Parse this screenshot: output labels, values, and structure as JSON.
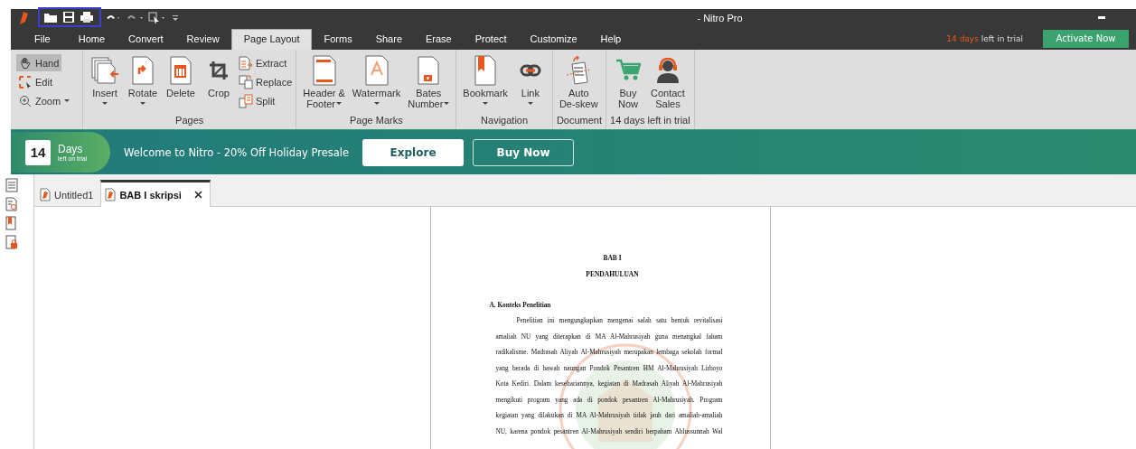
{
  "window": {
    "title": "- Nitro Pro"
  },
  "menu_tabs": [
    {
      "label": "File",
      "selected": false
    },
    {
      "label": "Home",
      "selected": false
    },
    {
      "label": "Convert",
      "selected": false
    },
    {
      "label": "Review",
      "selected": false
    },
    {
      "label": "Page Layout",
      "selected": true
    },
    {
      "label": "Forms",
      "selected": false
    },
    {
      "label": "Share",
      "selected": false
    },
    {
      "label": "Erase",
      "selected": false
    },
    {
      "label": "Protect",
      "selected": false
    },
    {
      "label": "Customize",
      "selected": false
    },
    {
      "label": "Help",
      "selected": false
    }
  ],
  "trial_notice": {
    "days": "14 days",
    "text": "left in trial"
  },
  "activate_button": "Activate Now",
  "tools": [
    {
      "label": "Hand",
      "selected": true,
      "dropdown": false
    },
    {
      "label": "Edit",
      "selected": false,
      "dropdown": false
    },
    {
      "label": "Zoom",
      "selected": false,
      "dropdown": true
    }
  ],
  "ribbon_groups": [
    {
      "label": "Pages",
      "buttons": [
        {
          "kind": "large",
          "lines": [
            "Insert"
          ],
          "dropdown": true
        },
        {
          "kind": "large",
          "lines": [
            "Rotate"
          ],
          "dropdown": true
        },
        {
          "kind": "large",
          "lines": [
            "Delete"
          ]
        },
        {
          "kind": "large",
          "lines": [
            "Crop"
          ]
        },
        {
          "kind": "small",
          "lines": [
            "Extract"
          ]
        },
        {
          "kind": "small",
          "lines": [
            "Replace"
          ]
        },
        {
          "kind": "small",
          "lines": [
            "Split"
          ]
        }
      ]
    },
    {
      "label": "Page Marks",
      "buttons": [
        {
          "kind": "large",
          "lines": [
            "Header &",
            "Footer"
          ],
          "dropdown": true
        },
        {
          "kind": "large",
          "lines": [
            "Watermark"
          ],
          "dropdown": true
        },
        {
          "kind": "large",
          "lines": [
            "Bates",
            "Number"
          ],
          "dropdown": true
        }
      ]
    },
    {
      "label": "Navigation",
      "buttons": [
        {
          "kind": "large",
          "lines": [
            "Bookmark"
          ],
          "dropdown": true
        },
        {
          "kind": "large",
          "lines": [
            "Link"
          ],
          "dropdown": true
        }
      ]
    },
    {
      "label": "Document",
      "buttons": [
        {
          "kind": "large",
          "lines": [
            "Auto",
            "De-skew"
          ]
        }
      ]
    },
    {
      "label": "14 days left in trial",
      "buttons": [
        {
          "kind": "large",
          "lines": [
            "Buy",
            "Now"
          ]
        },
        {
          "kind": "large",
          "lines": [
            "Contact",
            "Sales"
          ]
        }
      ]
    }
  ],
  "banner": {
    "days": "14",
    "days_label": "Days",
    "days_sub": "left on trial",
    "message": "Welcome to Nitro - 20% Off Holiday Presale",
    "buttons": [
      {
        "label": "Explore",
        "kind": "filled"
      },
      {
        "label": "Buy Now",
        "kind": "outline"
      }
    ]
  },
  "doc_tabs": [
    {
      "label": "Untitled1",
      "selected": false,
      "closable": false
    },
    {
      "label": "BAB I skripsi",
      "selected": true,
      "closable": true
    }
  ],
  "document": {
    "heading": "BAB I",
    "subheading": "PENDAHULUAN",
    "section": "A.  Konteks Penelitian",
    "lines": [
      "Penelitian ini mengungkapkan mengenai salah satu bentuk revitalisasi",
      "amaliah NU yang diterapkan di MA Al-Mahrusiyah guna menangkal faham",
      "radikalisme. Madrasah Aliyah Al-Mahrusiyah merupakan lembaga sekolah formal",
      "yang berada di bawah naungan Pondok Pesantren HM Al-Mahrusiyah Lirboyo",
      "Kota Kediri. Dalam kesehariannya, kegiatan di Madrasah Aliyah Al-Mahrusiyah",
      "mengikuti program yang ada di pondok pesantren Al-Mahrusiyah. Program",
      "kegiatan yang dilakukan di MA Al-Mahrusiyah tidak jauh dari amaliah-amaliah",
      "NU, karena pondok pesantren Al-Mahrusiyah sendiri berpaham Ahlussunnah Wal"
    ]
  }
}
